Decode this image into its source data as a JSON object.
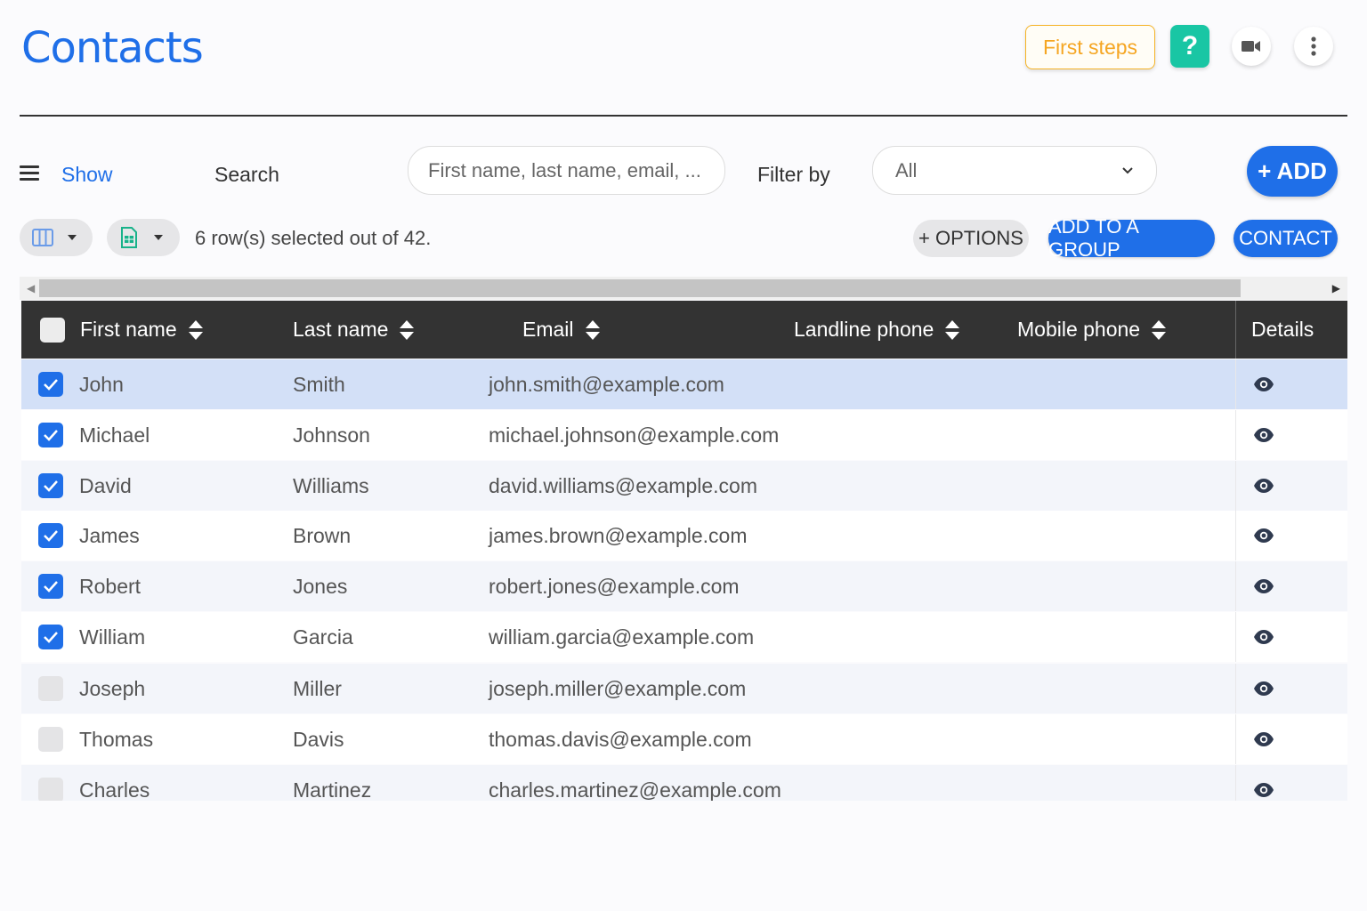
{
  "header": {
    "title": "Contacts",
    "first_steps_label": "First steps",
    "help_label": "?",
    "video_icon": "video-camera-icon",
    "more_icon": "more-vertical-icon"
  },
  "toolbar": {
    "show_label": "Show",
    "search_label": "Search",
    "search_placeholder": "First name, last name, email, ...",
    "filter_label": "Filter by",
    "filter_value": "All",
    "add_label": "+ ADD",
    "selection_text": "6 row(s) selected out of 42.",
    "options_label": "+ OPTIONS",
    "add_to_group_label": "ADD TO A GROUP",
    "contact_label": "CONTACT"
  },
  "table": {
    "columns": [
      "First name",
      "Last name",
      "Email",
      "Landline phone",
      "Mobile phone",
      "Details"
    ],
    "rows": [
      {
        "first": "John",
        "last": "Smith",
        "email": "john.smith@example.com",
        "landline": "",
        "mobile": "",
        "checked": true
      },
      {
        "first": "Michael",
        "last": "Johnson",
        "email": "michael.johnson@example.com",
        "landline": "",
        "mobile": "",
        "checked": true
      },
      {
        "first": "David",
        "last": "Williams",
        "email": "david.williams@example.com",
        "landline": "",
        "mobile": "",
        "checked": true
      },
      {
        "first": "James",
        "last": "Brown",
        "email": "james.brown@example.com",
        "landline": "",
        "mobile": "",
        "checked": true
      },
      {
        "first": "Robert",
        "last": "Jones",
        "email": "robert.jones@example.com",
        "landline": "",
        "mobile": "",
        "checked": true
      },
      {
        "first": "William",
        "last": "Garcia",
        "email": "william.garcia@example.com",
        "landline": "",
        "mobile": "",
        "checked": true
      },
      {
        "first": "Joseph",
        "last": "Miller",
        "email": "joseph.miller@example.com",
        "landline": "",
        "mobile": "",
        "checked": false
      },
      {
        "first": "Thomas",
        "last": "Davis",
        "email": "thomas.davis@example.com",
        "landline": "",
        "mobile": "",
        "checked": false
      },
      {
        "first": "Charles",
        "last": "Martinez",
        "email": "charles.martinez@example.com",
        "landline": "",
        "mobile": "",
        "checked": false
      }
    ]
  },
  "colors": {
    "accent": "#1f6fe8",
    "help": "#19c6a4",
    "first_steps": "#f5a623",
    "header_bg": "#333333",
    "highlight_row": "#d3e0f7"
  }
}
